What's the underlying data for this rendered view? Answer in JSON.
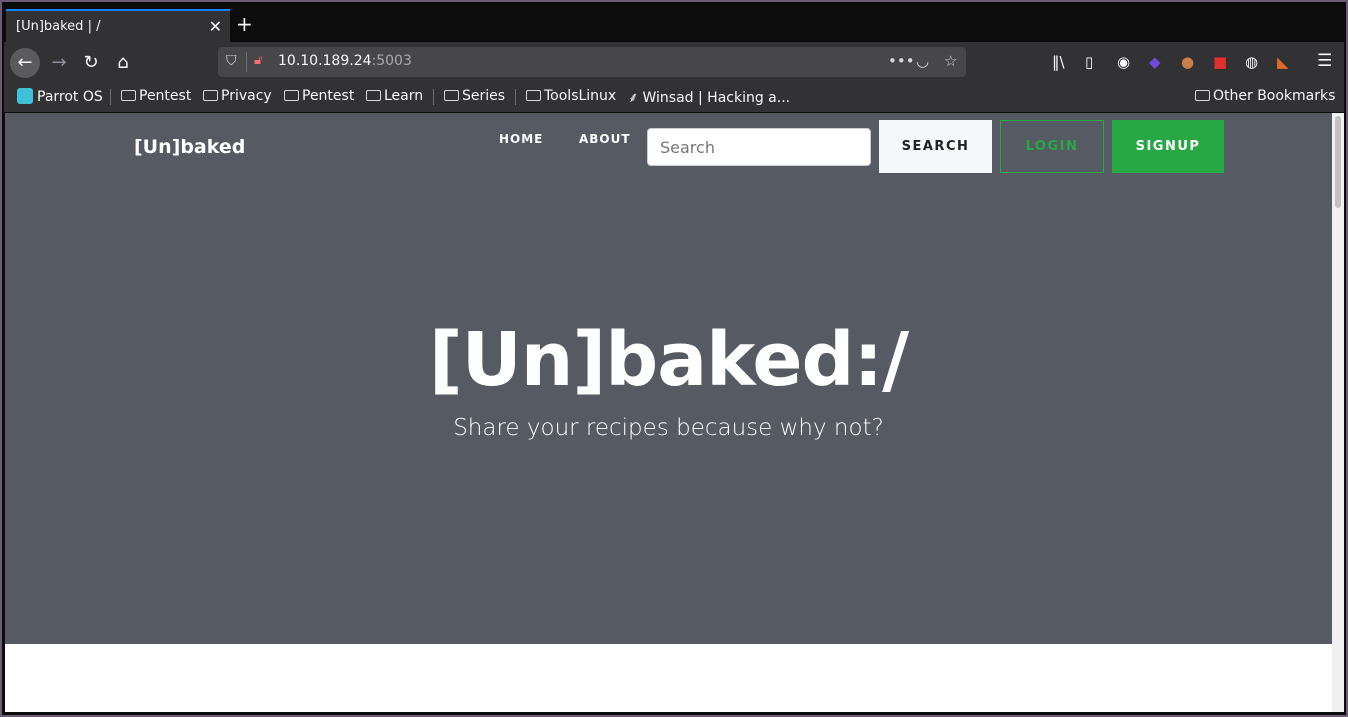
{
  "browser": {
    "tab_title": "[Un]baked | /",
    "tab_close": "✕",
    "new_tab": "+",
    "url_host": "10.10.189.24",
    "url_port": ":5003",
    "back_icon": "←",
    "forward_icon": "→",
    "reload_icon": "↻",
    "home_icon": "⌂",
    "menu_icon": "☰"
  },
  "bookmarks": {
    "items": [
      "Parrot OS",
      "Pentest",
      "Privacy",
      "Pentest",
      "Learn",
      "Series",
      "ToolsLinux",
      "Winsad | Hacking a..."
    ],
    "other": "Other Bookmarks"
  },
  "site": {
    "brand": "[Un]baked",
    "nav": {
      "home": "HOME",
      "about": "ABOUT"
    },
    "search_placeholder": "Search",
    "search_button": "SEARCH",
    "login_button": "LOGIN",
    "signup_button": "SIGNUP",
    "hero_title": "[Un]baked:/",
    "hero_subtitle": "Share your recipes because why not?"
  },
  "colors": {
    "hero_bg": "#565a63",
    "accent_green": "#28a745",
    "tab_accent": "#0a84ff"
  }
}
